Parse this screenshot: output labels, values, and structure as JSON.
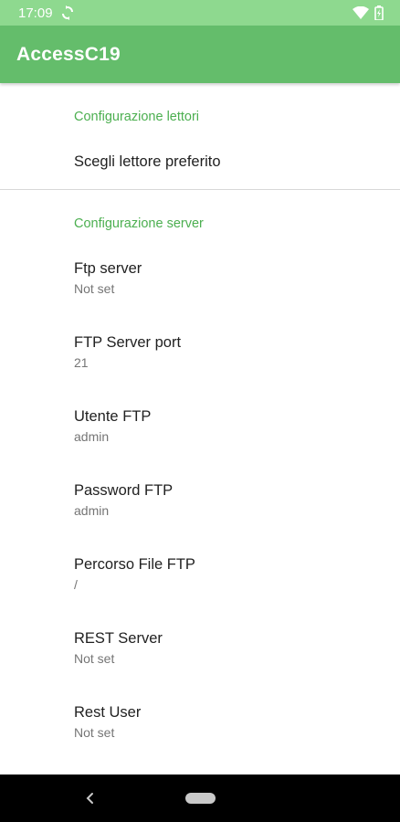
{
  "status_bar": {
    "time": "17:09",
    "icons": [
      "sync-icon",
      "wifi-icon",
      "battery-charging-icon"
    ]
  },
  "app_bar": {
    "title": "AccessC19"
  },
  "sections": [
    {
      "header": "Configurazione lettori",
      "items": [
        {
          "title": "Scegli lettore preferito",
          "summary": ""
        }
      ]
    },
    {
      "header": "Configurazione server",
      "items": [
        {
          "title": "Ftp server",
          "summary": "Not set"
        },
        {
          "title": "FTP Server port",
          "summary": "21"
        },
        {
          "title": "Utente FTP",
          "summary": "admin"
        },
        {
          "title": "Password FTP",
          "summary": "admin"
        },
        {
          "title": "Percorso File FTP",
          "summary": "/"
        },
        {
          "title": "REST Server",
          "summary": "Not set"
        },
        {
          "title": "Rest User",
          "summary": "Not set"
        }
      ]
    }
  ],
  "nav_bar": {
    "icons": [
      "back-icon",
      "home-pill-icon"
    ]
  },
  "colors": {
    "status_bar": "#8ed98f",
    "app_bar": "#64bd6b",
    "accent": "#4caf50",
    "title_text": "#212121",
    "summary_text": "#757575"
  }
}
